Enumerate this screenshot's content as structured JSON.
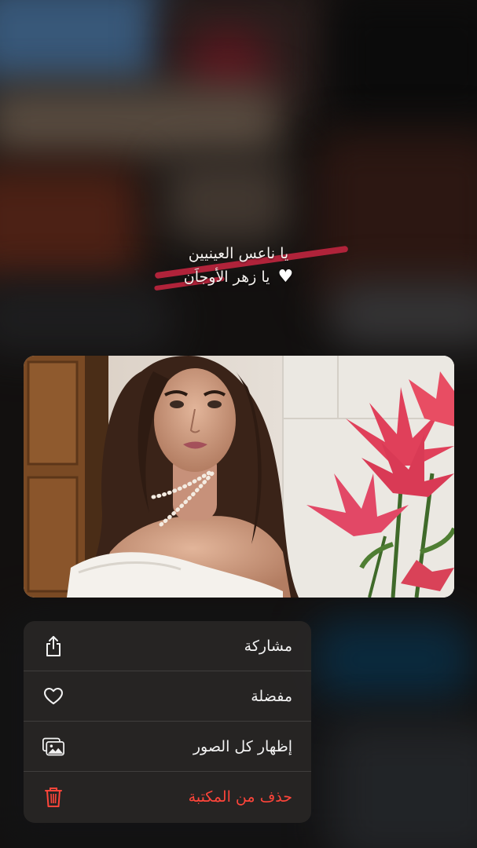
{
  "caption": {
    "line1": "يا ناعس العينيين",
    "line2": "يا زهر الأوجاَن",
    "heart": "♥"
  },
  "photo": {
    "icon": "portrait-photo"
  },
  "menu": {
    "items": [
      {
        "label": "مشاركة",
        "icon": "share-icon"
      },
      {
        "label": "مفضلة",
        "icon": "heart-icon"
      },
      {
        "label": "إظهار كل الصور",
        "icon": "photos-icon"
      },
      {
        "label": "حذف من المكتبة",
        "icon": "trash-icon",
        "destructive": true
      }
    ]
  },
  "colors": {
    "destructive": "#ff453a",
    "menu_background": "#2a2726",
    "accent_strike": "#b0233a"
  }
}
